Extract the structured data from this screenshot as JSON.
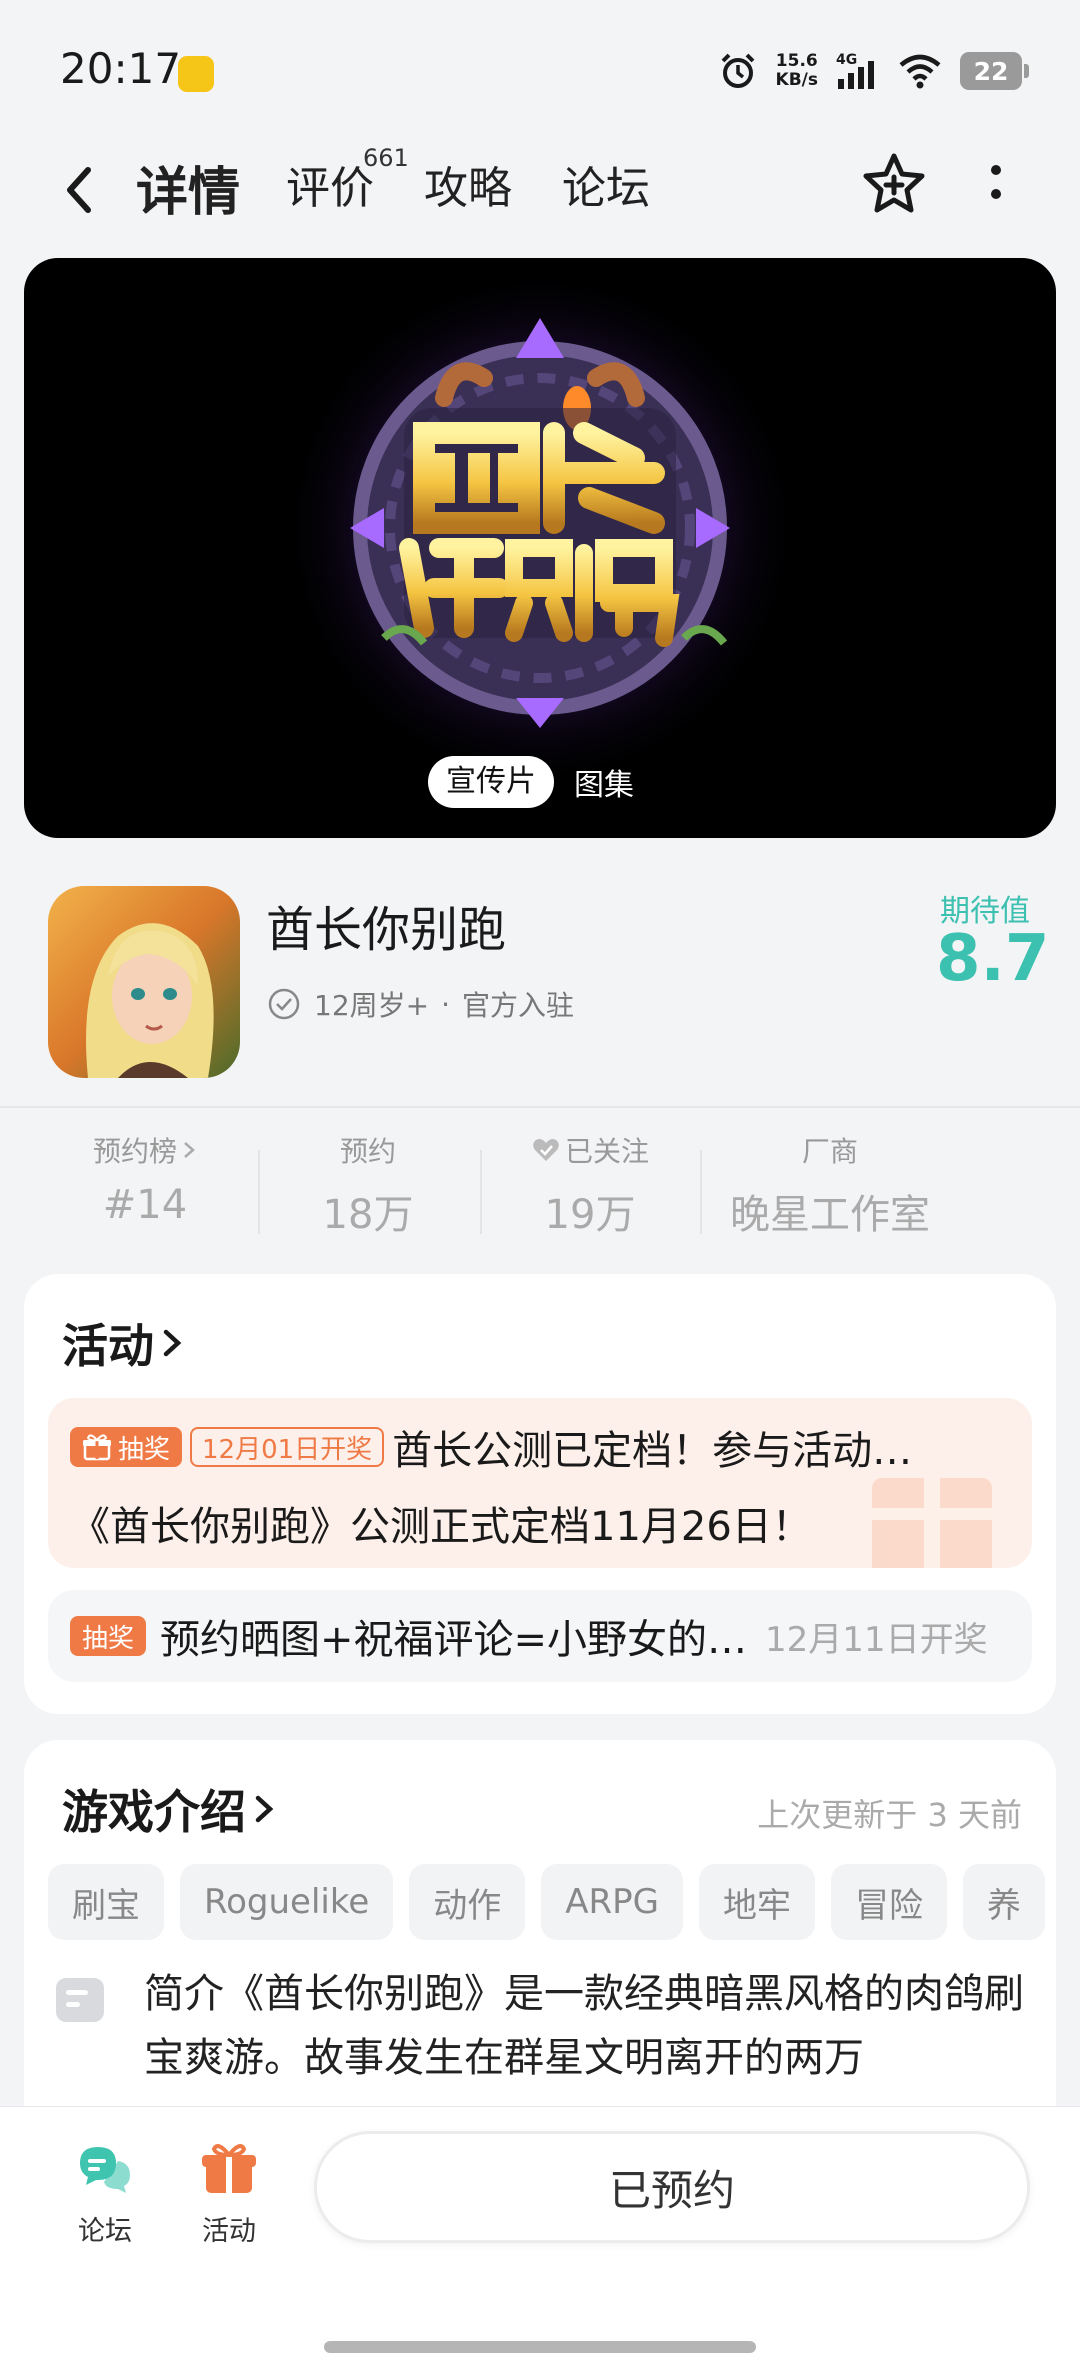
{
  "status_bar": {
    "time": "20:17",
    "net_speed_value": "15.6",
    "net_speed_unit": "KB/s",
    "network": "4G",
    "battery": "22"
  },
  "nav": {
    "tabs": [
      {
        "label": "详情",
        "active": true
      },
      {
        "label": "评价",
        "count": "661"
      },
      {
        "label": "攻略"
      },
      {
        "label": "论坛"
      }
    ]
  },
  "hero": {
    "switch": [
      "宣传片",
      "图集"
    ]
  },
  "game": {
    "title": "酋长你别跑",
    "age": "12周岁+",
    "official": "官方入驻",
    "expect_label": "期待值",
    "expect_value": "8.7"
  },
  "stats": [
    {
      "label": "预约榜",
      "value": "#14"
    },
    {
      "label": "预约",
      "value": "18万"
    },
    {
      "label": "已关注",
      "value": "19万"
    },
    {
      "label": "厂商",
      "value": "晚星工作室"
    }
  ],
  "activity": {
    "title": "活动",
    "items": [
      {
        "badge": "抽奖",
        "date_badge": "12月01日开奖",
        "title": "酋长公测已定档！参与活动…",
        "subtitle": "《酋长你别跑》公测正式定档11月26日！"
      },
      {
        "badge": "抽奖",
        "title": "预约晒图+祝福评论=小野女的…",
        "date": "12月11日开奖"
      }
    ]
  },
  "intro": {
    "title": "游戏介绍",
    "updated": "上次更新于 3 天前",
    "tags": [
      "刷宝",
      "Roguelike",
      "动作",
      "ARPG",
      "地牢",
      "冒险",
      "养"
    ],
    "text": "简介《酋长你别跑》是一款经典暗黑风格的肉鸽刷宝爽游。故事发生在群星文明离开的两万"
  },
  "bottom_bar": {
    "forum_label": "论坛",
    "activity_label": "活动",
    "reserve_label": "已预约"
  },
  "colors": {
    "accent": "#4fd1c5",
    "expect": "#3cc0b0",
    "lottery": "#f07a45"
  }
}
